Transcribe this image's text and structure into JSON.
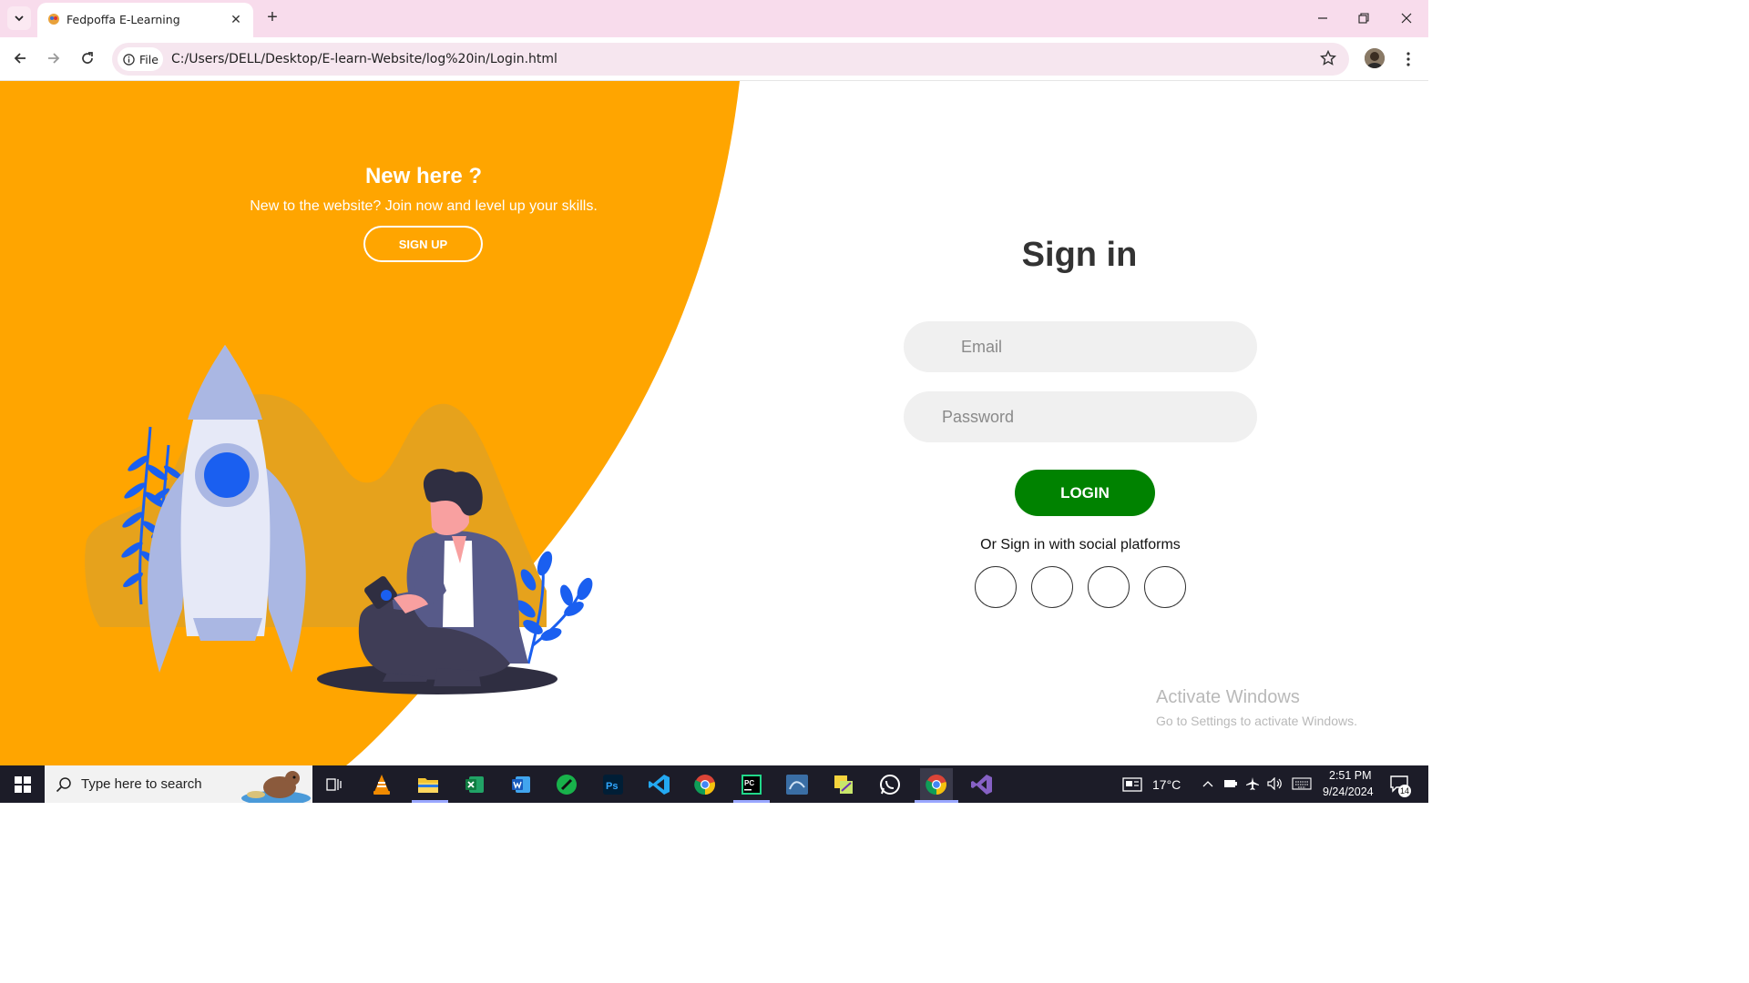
{
  "browser": {
    "tab_title": "Fedpoffa E-Learning",
    "address_chip_label": "File",
    "url": "C:/Users/DELL/Desktop/E-learn-Website/log%20in/Login.html"
  },
  "panel": {
    "title": "New here ?",
    "subtitle": "New to the website? Join now and level up your skills.",
    "signup_label": "SIGN UP"
  },
  "form": {
    "title": "Sign in",
    "email_placeholder": "Email",
    "password_placeholder": "Password",
    "login_label": "LOGIN",
    "social_text": "Or Sign in with social platforms"
  },
  "watermark": {
    "line1": "Activate Windows",
    "line2": "Go to Settings to activate Windows."
  },
  "taskbar": {
    "search_placeholder": "Type here to search",
    "temperature": "17°C",
    "time": "2:51 PM",
    "date": "9/24/2024",
    "notification_count": "14"
  },
  "colors": {
    "panel_orange": "#FFA500",
    "login_green": "#008200",
    "illustration_blue": "#1a5ff0"
  }
}
